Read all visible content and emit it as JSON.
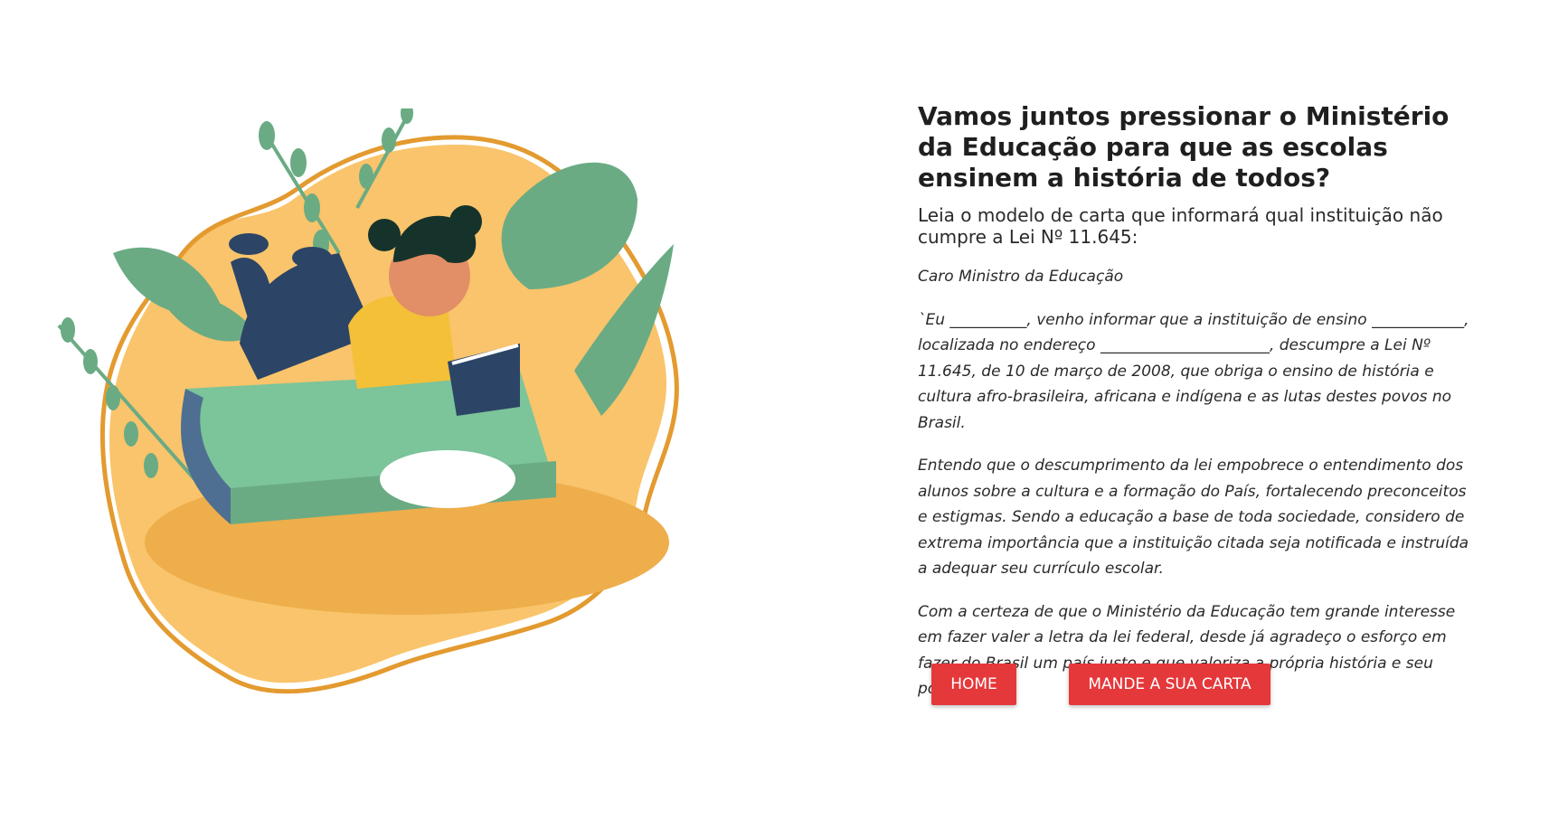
{
  "main": {
    "title": "Vamos juntos pressionar o Ministério da Educação para que as escolas ensinem a história de todos?",
    "subtitle": "Leia o modelo de carta que informará qual instituição não cumpre a Lei Nº 11.645:",
    "letter": {
      "greeting": "Caro Ministro da Educação",
      "paragraph1": "`Eu __________, venho informar que a instituição de ensino ____________, localizada no endereço ______________________, descumpre a Lei Nº 11.645, de 10 de março de 2008, que obriga o ensino de história e cultura afro-brasileira, africana e indígena e as lutas destes povos no Brasil.",
      "paragraph2": "Entendo que o descumprimento da lei empobrece o entendimento dos alunos sobre a cultura e a formação do País, fortalecendo preconceitos e estigmas. Sendo a educação a base de toda sociedade, considero de extrema importância que a instituição citada seja notificada e instruída a adequar seu currículo escolar.",
      "paragraph3": "Com a certeza de que o Ministério da Educação tem grande interesse em fazer valer a letra da lei federal, desde já agradeço o esforço em fazer do Brasil um país justo e que valoriza a própria história e seu povo."
    },
    "buttons": {
      "home_label": "HOME",
      "send_label": "MANDE A SUA CARTA"
    }
  },
  "colors": {
    "button": "#e5383b",
    "blob": "#f9c46b",
    "blob_outline": "#e39a2f",
    "leaf": "#6aab84",
    "book": "#7cc49a"
  },
  "illustration": {
    "icon": "girl-reading-on-book-illustration"
  }
}
